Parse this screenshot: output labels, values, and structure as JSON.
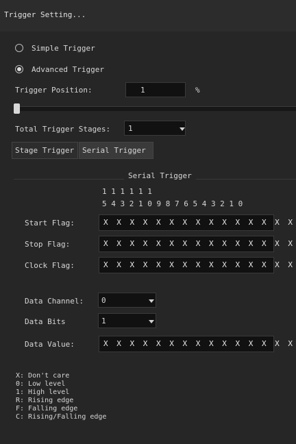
{
  "window": {
    "title": "Trigger Setting..."
  },
  "trigger_mode": {
    "simple_label": "Simple Trigger",
    "advanced_label": "Advanced Trigger",
    "selected": "Advanced Trigger"
  },
  "trigger_position": {
    "label": "Trigger Position:",
    "value": "1",
    "unit": "%",
    "slider_fraction": 0.01
  },
  "stages": {
    "label": "Total Trigger Stages:",
    "value": "1"
  },
  "tabs": [
    {
      "label": "Stage Trigger",
      "active": false
    },
    {
      "label": "Serial Trigger",
      "active": true
    }
  ],
  "serial": {
    "group_title": "Serial Trigger",
    "bit_header_top": "1 1 1 1 1 1",
    "bit_header_bottom": "5 4 3 2 1 0 9 8 7 6 5 4 3 2 1 0",
    "start_flag": {
      "label": "Start Flag:",
      "value": "X X X X X X X X X X X X X X X X"
    },
    "stop_flag": {
      "label": "Stop Flag:",
      "value": "X X X X X X X X X X X X X X X X"
    },
    "clock_flag": {
      "label": "Clock Flag:",
      "value": "X X X X X X X X X X X X X X X X"
    },
    "data_channel": {
      "label": "Data Channel:",
      "value": "0"
    },
    "data_bits": {
      "label": "Data Bits",
      "value": "1"
    },
    "data_value": {
      "label": "Data Value:",
      "value": "X X X X X X X X X X X X X X X X"
    }
  },
  "legend": [
    "X: Don't care",
    "0: Low level",
    "1: High level",
    "R: Rising edge",
    "F: Falling edge",
    "C: Rising/Falling edge"
  ]
}
